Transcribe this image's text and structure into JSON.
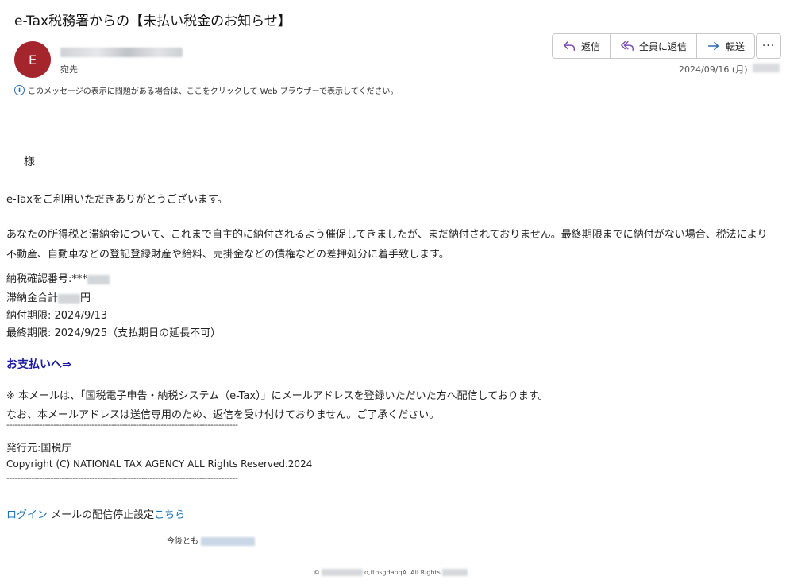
{
  "header": {
    "subject": "e-Tax税務署からの【未払い税金のお知らせ】",
    "avatar_initial": "E",
    "to_label": "宛先",
    "date": "2024/09/16 (月)",
    "info_message": "このメッセージの表示に問題がある場合は、ここをクリックして Web ブラウザーで表示してください。"
  },
  "actions": {
    "reply": "返信",
    "reply_all": "全員に返信",
    "forward": "転送",
    "more": "···"
  },
  "colors": {
    "avatar_bg": "#a4262c",
    "link": "#1a1aa6",
    "secondary_link": "#1a73b8",
    "action_icon": "#7a4fb0",
    "forward_icon": "#2b6cb0"
  },
  "body": {
    "salutation": "様",
    "greeting": "e-Taxをご利用いただきありがとうございます。",
    "paragraph": "あなたの所得税と滞納金について、これまで自主的に納付されるよう催促してきましたが、まだ納付されておりません。最終期限までに納付がない場合、税法により不動産、自動車などの登記登録財産や給料、売掛金などの債権などの差押処分に着手致します。",
    "confirm_number_label": "納税確認番号:***",
    "delinquent_total_label": "滞納金合計",
    "delinquent_total_suffix": "円",
    "due_date": "納付期限: 2024/9/13",
    "final_due_date": "最終期限: 2024/9/25（支払期日の延長不可）",
    "pay_link": "お支払いへ⇒",
    "note1": "※ 本メールは、「国税電子申告・納税システム（e-Tax）」にメールアドレスを登録いただいた方へ配信しております。",
    "note2": "なお、本メールアドレスは送信専用のため、返信を受け付けておりません。ご了承ください。",
    "divider": "------------------------------------------------------------------------------------",
    "publisher": "発行元:国税庁",
    "copyright": "Copyright (C) NATIONAL TAX AGENCY ALL Rights Reserved.2024",
    "login_link": "ログイン",
    "unsubscribe_text": " メールの配信停止設定",
    "unsubscribe_link": "こちら",
    "future_text": "今後とも",
    "footer_prefix": "©",
    "footer_text": "o,fthsgdapqA. All Rights"
  }
}
